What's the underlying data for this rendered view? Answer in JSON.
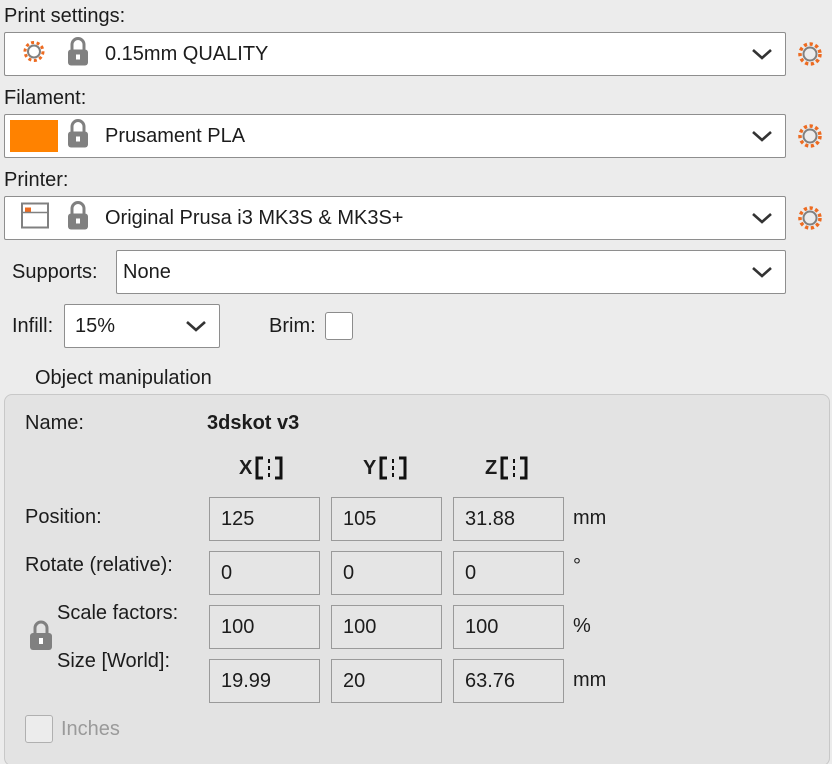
{
  "print_settings": {
    "label": "Print settings:",
    "value": "0.15mm QUALITY",
    "icon": "gear-icon"
  },
  "filament": {
    "label": "Filament:",
    "value": "Prusament PLA",
    "swatch_color": "#ff8200"
  },
  "printer": {
    "label": "Printer:",
    "value": "Original Prusa i3 MK3S & MK3S+"
  },
  "supports": {
    "label": "Supports:",
    "value": "None"
  },
  "infill": {
    "label": "Infill:",
    "value": "15%"
  },
  "brim": {
    "label": "Brim:",
    "checked": false
  },
  "object_manipulation": {
    "title": "Object manipulation",
    "name_label": "Name:",
    "name_value": "3dskot v3",
    "axes": [
      "X",
      "Y",
      "Z"
    ],
    "position": {
      "label": "Position:",
      "x": "125",
      "y": "105",
      "z": "31.88",
      "unit": "mm"
    },
    "rotate": {
      "label": "Rotate (relative):",
      "x": "0",
      "y": "0",
      "z": "0",
      "unit": "°"
    },
    "scale": {
      "label": "Scale factors:",
      "x": "100",
      "y": "100",
      "z": "100",
      "unit": "%"
    },
    "size": {
      "label": "Size [World]:",
      "x": "19.99",
      "y": "20",
      "z": "63.76",
      "unit": "mm"
    },
    "inches_label": "Inches",
    "inches_checked": false
  },
  "colors": {
    "accent": "#ed6b21",
    "lock_grey": "#808080"
  }
}
